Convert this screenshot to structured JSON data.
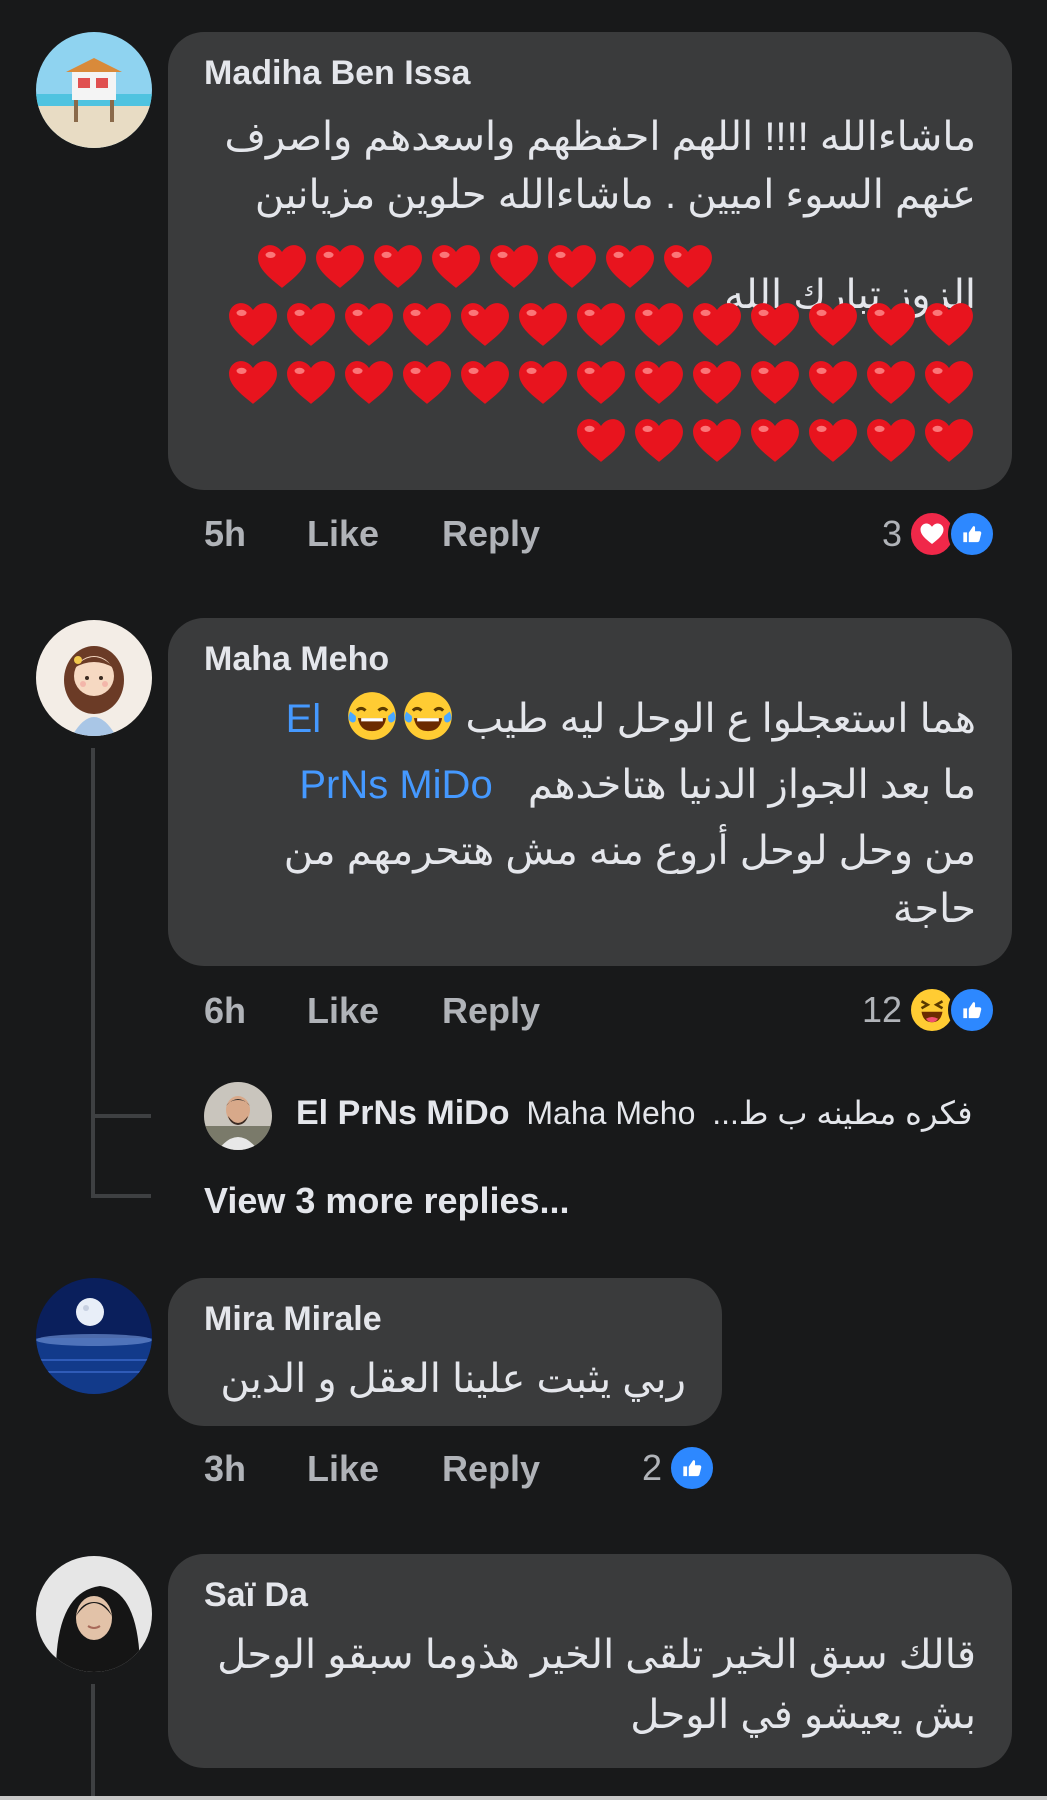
{
  "comments": [
    {
      "author": "Madiha Ben Issa",
      "lines": [
        "ماشاءالله !!!! اللهم احفظهم واسعدهم واصرف",
        "عنهم السوء اميين . ماشاءالله حلوين مزيانين",
        "الزوز تبارك الله"
      ],
      "time": "5h",
      "like": "Like",
      "reply": "Reply",
      "count": "3",
      "reactions": [
        "heart-reaction",
        "like-reaction"
      ]
    },
    {
      "author": "Maha Meho",
      "line1": "هما استعجلوا ع الوحل ليه طيب",
      "mention_a": "El",
      "mention_b": "PrNs MiDo",
      "line2": "ما بعد الجواز الدنيا هتاخدهم",
      "line3": "من وحل لوحل أروع منه مش هتحرمهم من",
      "line4": "حاجة",
      "time": "6h",
      "like": "Like",
      "reply": "Reply",
      "count": "12",
      "reactions": [
        "haha-reaction",
        "like-reaction"
      ],
      "sub_reply": {
        "author": "El PrNs MiDo",
        "mention": "Maha Meho",
        "snippet": "فكره مطينه ب ط..."
      },
      "more_replies": "View 3 more replies..."
    },
    {
      "author": "Mira Mirale",
      "line1": "ربي يثبت علينا العقل و الدين",
      "time": "3h",
      "like": "Like",
      "reply": "Reply",
      "count": "2",
      "reactions": [
        "like-reaction"
      ]
    },
    {
      "author": "Saï Da",
      "line1": "قالك سبق الخير تلقى الخير هذوما سبقو الوحل",
      "line2": "بش يعيشو في الوحل"
    }
  ],
  "colors": {
    "background": "#18191a",
    "bubble": "#3a3b3c",
    "mention": "#4599ff",
    "like_blue": "#2d88ff",
    "heart_red": "#f02849"
  }
}
